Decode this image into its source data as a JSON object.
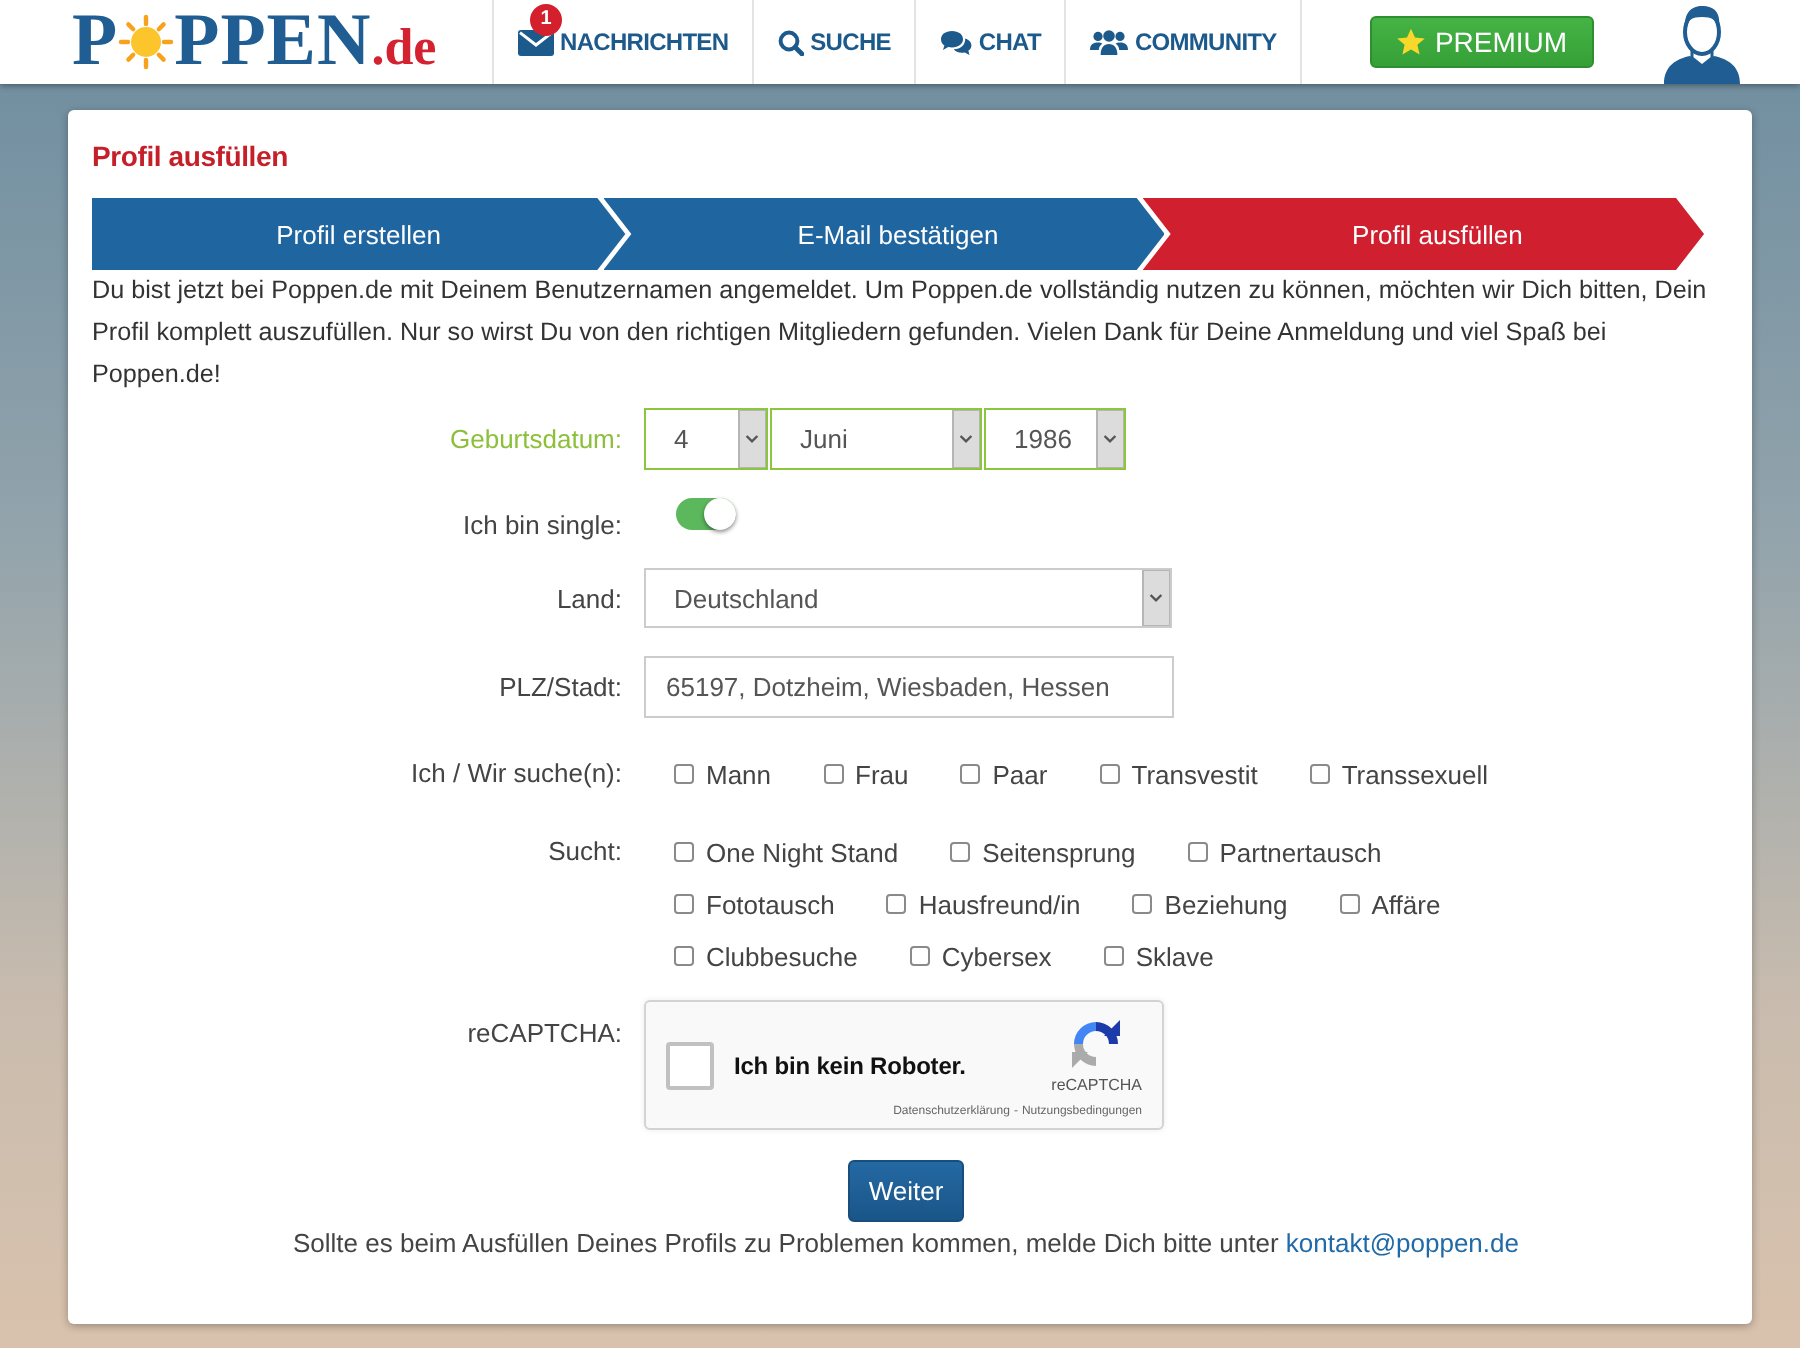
{
  "header": {
    "logo": {
      "letter": "P",
      "rest": "PPEN",
      "domain": ".de"
    },
    "nav": [
      {
        "kind": "messages",
        "label": "NACHRICHTEN",
        "badge": "1"
      },
      {
        "kind": "search",
        "label": "SUCHE"
      },
      {
        "kind": "chat",
        "label": "CHAT"
      },
      {
        "kind": "community",
        "label": "COMMUNITY"
      }
    ],
    "premium_button": "PREMIUM"
  },
  "card": {
    "title": "Profil ausfüllen",
    "steps": [
      {
        "label": "Profil erstellen",
        "selected": false
      },
      {
        "label": "E-Mail bestätigen",
        "selected": false
      },
      {
        "label": "Profil ausfüllen",
        "selected": true
      }
    ],
    "intro": "Du bist jetzt bei Poppen.de mit Deinem Benutzernamen angemeldet. Um Poppen.de vollständig nutzen zu können, möchten wir Dich bitten, Dein Profil komplett auszufüllen. Nur so wirst Du von den richtigen Mitgliedern gefunden. Vielen Dank für Deine Anmeldung und viel Spaß bei Poppen.de!",
    "form": {
      "birthdate": {
        "label": "Geburtsdatum:",
        "valid": true,
        "day": "4",
        "month": "Juni",
        "year": "1986"
      },
      "single": {
        "label": "Ich bin single:",
        "on": true
      },
      "country": {
        "label": "Land:",
        "value": "Deutschland"
      },
      "city": {
        "label": "PLZ/Stadt:",
        "value": "65197, Dotzheim, Wiesbaden, Hessen"
      },
      "looking_for": {
        "label": "Ich / Wir suche(n):",
        "options": [
          {
            "label": "Mann",
            "checked": false
          },
          {
            "label": "Frau",
            "checked": false
          },
          {
            "label": "Paar",
            "checked": false
          },
          {
            "label": "Transvestit",
            "checked": false
          },
          {
            "label": "Transsexuell",
            "checked": false
          }
        ]
      },
      "interests": {
        "label": "Sucht:",
        "rows": [
          [
            {
              "label": "One Night Stand",
              "checked": false
            },
            {
              "label": "Seitensprung",
              "checked": false
            },
            {
              "label": "Partnertausch",
              "checked": false
            }
          ],
          [
            {
              "label": "Fototausch",
              "checked": false
            },
            {
              "label": "Hausfreund/in",
              "checked": false
            },
            {
              "label": "Beziehung",
              "checked": false
            },
            {
              "label": "Affäre",
              "checked": false
            }
          ],
          [
            {
              "label": "Clubbesuche",
              "checked": false
            },
            {
              "label": "Cybersex",
              "checked": false
            },
            {
              "label": "Sklave",
              "checked": false
            }
          ]
        ]
      },
      "captcha": {
        "label": "reCAPTCHA:",
        "checked": false,
        "text": "Ich bin kein Roboter.",
        "brand": "reCAPTCHA",
        "privacy_link": "Datenschutzerklärung",
        "separator": "-",
        "terms_link": "Nutzungsbedingungen"
      }
    },
    "submit_button": "Weiter",
    "footer": {
      "text": "Sollte es beim Ausfüllen Deines Profils zu Problemen kommen, melde Dich bitte unter",
      "link": "kontakt@poppen.de"
    }
  }
}
